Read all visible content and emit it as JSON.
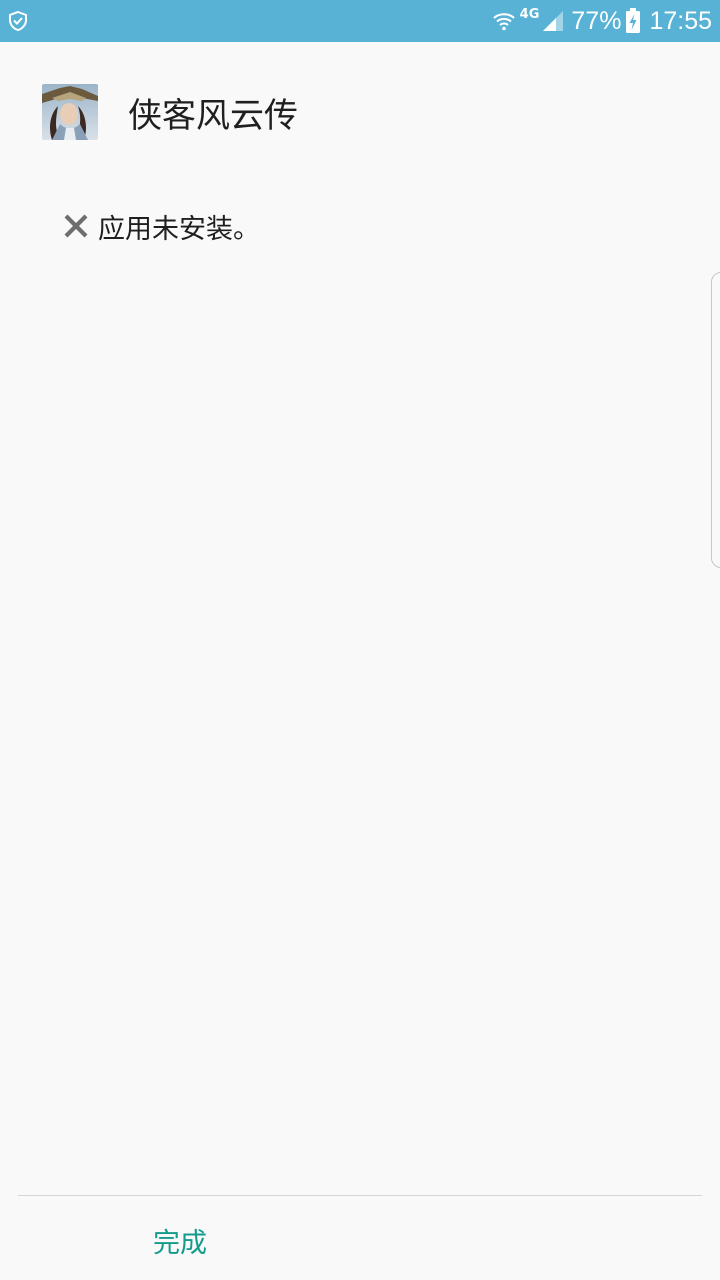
{
  "status_bar": {
    "background_color": "#58b2d6",
    "left_icon": "shield-check-icon",
    "network_type": "4G",
    "battery_percent": "77%",
    "battery_charging": true,
    "time": "17:55"
  },
  "app": {
    "icon": "game-app-icon",
    "name": "侠客风云传"
  },
  "message": {
    "icon": "close-x-icon",
    "text": "应用未安装。"
  },
  "footer": {
    "done_label": "完成",
    "accent_color": "#139c8c"
  }
}
